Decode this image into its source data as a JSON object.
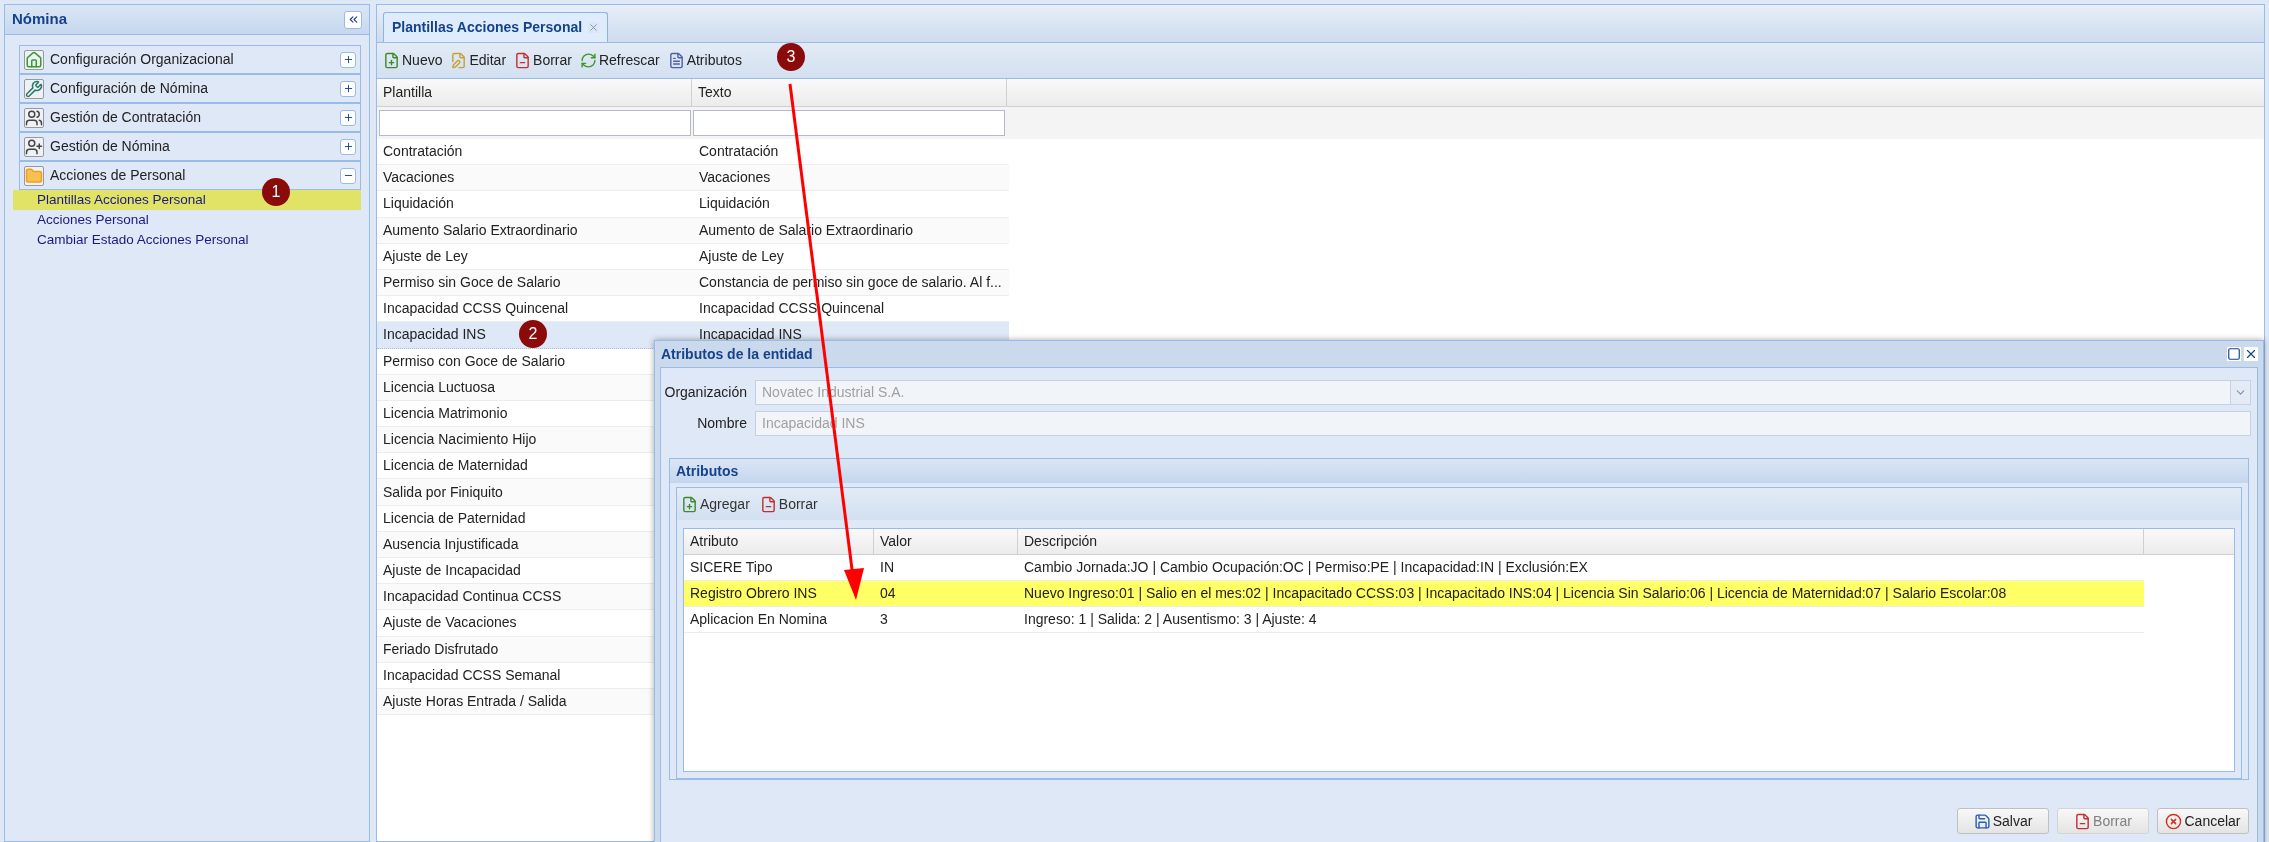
{
  "sidebar": {
    "title": "Nómina",
    "sections": [
      {
        "label": "Configuración Organizacional",
        "expanded": false
      },
      {
        "label": "Configuración de Nómina",
        "expanded": false
      },
      {
        "label": "Gestión de Contratación",
        "expanded": false
      },
      {
        "label": "Gestión de Nómina",
        "expanded": false
      },
      {
        "label": "Acciones de Personal",
        "expanded": true,
        "children": [
          {
            "label": "Plantillas Acciones Personal",
            "selected": true
          },
          {
            "label": "Acciones Personal",
            "selected": false
          },
          {
            "label": "Cambiar Estado Acciones Personal",
            "selected": false
          }
        ]
      }
    ]
  },
  "tabs": [
    {
      "label": "Plantillas Acciones Personal",
      "selected": true
    }
  ],
  "toolbar": [
    "Nuevo",
    "Editar",
    "Borrar",
    "Refrescar",
    "Atributos"
  ],
  "table": {
    "columns": [
      "Plantilla",
      "Texto"
    ],
    "rows": [
      {
        "plantilla": "Contratación",
        "texto": "Contratación",
        "selected": false
      },
      {
        "plantilla": "Vacaciones",
        "texto": "Vacaciones",
        "selected": false
      },
      {
        "plantilla": "Liquidación",
        "texto": "Liquidación",
        "selected": false
      },
      {
        "plantilla": "Aumento Salario Extraordinario",
        "texto": "Aumento de Salario Extraordinario",
        "selected": false
      },
      {
        "plantilla": "Ajuste de Ley",
        "texto": "Ajuste de Ley",
        "selected": false
      },
      {
        "plantilla": "Permiso sin Goce de Salario",
        "texto": "Constancia de permiso sin goce de salario. Al f...",
        "selected": false
      },
      {
        "plantilla": "Incapacidad CCSS Quincenal",
        "texto": "Incapacidad CCSS Quincenal",
        "selected": false
      },
      {
        "plantilla": "Incapacidad INS",
        "texto": "Incapacidad INS",
        "selected": true
      },
      {
        "plantilla": "Permiso con Goce de Salario",
        "selected": false
      },
      {
        "plantilla": "Licencia Luctuosa",
        "selected": false
      },
      {
        "plantilla": "Licencia Matrimonio",
        "selected": false
      },
      {
        "plantilla": "Licencia Nacimiento Hijo",
        "selected": false
      },
      {
        "plantilla": "Licencia de Maternidad",
        "selected": false
      },
      {
        "plantilla": "Salida por Finiquito",
        "selected": false
      },
      {
        "plantilla": "Licencia de Paternidad",
        "selected": false
      },
      {
        "plantilla": "Ausencia Injustificada",
        "selected": false
      },
      {
        "plantilla": "Ajuste de Incapacidad",
        "selected": false
      },
      {
        "plantilla": "Incapacidad Continua CCSS",
        "selected": false
      },
      {
        "plantilla": "Ajuste de Vacaciones",
        "selected": false
      },
      {
        "plantilla": "Feriado Disfrutado",
        "selected": false
      },
      {
        "plantilla": "Incapacidad CCSS Semanal",
        "selected": false
      },
      {
        "plantilla": "Ajuste Horas Entrada / Salida",
        "selected": false
      }
    ]
  },
  "dialog": {
    "title": "Atributos de la entidad",
    "fields": [
      {
        "label": "Organización",
        "value": "Novatec Industrial S.A.",
        "kind": "select",
        "disabled": true
      },
      {
        "label": "Nombre",
        "value": "Incapacidad INS",
        "kind": "text",
        "disabled": true
      }
    ],
    "panel": {
      "title": "Atributos",
      "toolbar": [
        "Agregar",
        "Borrar"
      ],
      "columns": [
        "Atributo",
        "Valor",
        "Descripción"
      ],
      "rows": [
        {
          "atributo": "SICERE Tipo",
          "valor": "IN",
          "descripcion": "Cambio Jornada:JO | Cambio Ocupación:OC | Permiso:PE | Incapacidad:IN | Exclusión:EX",
          "highlighted": false
        },
        {
          "atributo": "Registro Obrero INS",
          "valor": "04",
          "descripcion": "Nuevo Ingreso:01 | Salio en el mes:02 | Incapacitado CCSS:03 | Incapacitado INS:04 | Licencia Sin Salario:06 | Licencia de Maternidad:07 | Salario Escolar:08",
          "highlighted": true
        },
        {
          "atributo": "Aplicacion En Nomina",
          "valor": "3",
          "descripcion": "Ingreso: 1 | Salida: 2 | Ausentismo: 3 | Ajuste: 4",
          "highlighted": false
        }
      ]
    },
    "buttons": [
      {
        "label": "Salvar",
        "disabled": false
      },
      {
        "label": "Borrar",
        "disabled": true
      },
      {
        "label": "Cancelar",
        "disabled": false
      }
    ]
  },
  "annotations": [
    {
      "label": "1"
    },
    {
      "label": "2"
    },
    {
      "label": "3"
    }
  ]
}
